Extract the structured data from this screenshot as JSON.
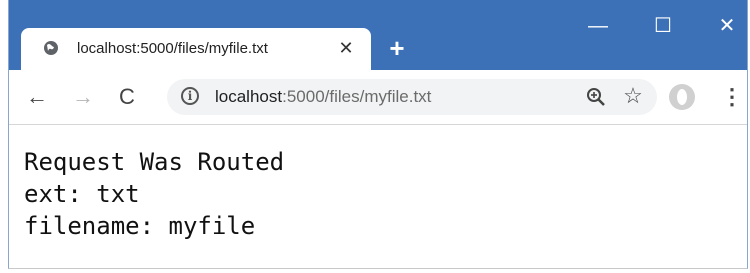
{
  "tab": {
    "title": "localhost:5000/files/myfile.txt",
    "close_glyph": "✕"
  },
  "new_tab_glyph": "+",
  "window_controls": {
    "minimize": "—",
    "maximize": "☐",
    "close": "✕"
  },
  "nav": {
    "back": "←",
    "forward": "→",
    "reload": "C"
  },
  "address": {
    "host": "localhost",
    "path": ":5000/files/myfile.txt"
  },
  "icons": {
    "tab": "globe-icon",
    "site_info": "info-icon",
    "zoom": "zoom-icon",
    "bookmark": "star-icon",
    "profile": "profile-icon",
    "menu": "menu-icon"
  },
  "menu_glyph": "⋮",
  "star_glyph": "☆",
  "page": {
    "lines": [
      "Request Was Routed",
      "ext: txt",
      "filename: myfile"
    ]
  },
  "colors": {
    "titlebar": "#3c71b8",
    "omnibox": "#f1f3f4"
  }
}
